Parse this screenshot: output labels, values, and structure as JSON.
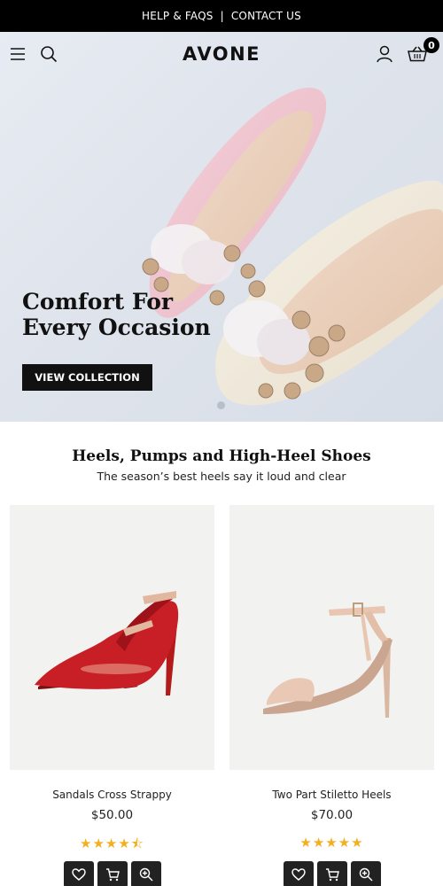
{
  "announcement": {
    "help_label": "HELP & FAQS",
    "separator": "|",
    "contact_label": "CONTACT US"
  },
  "header": {
    "logo": "AVONE",
    "cart_count": "0",
    "icons": [
      "menu-icon",
      "search-icon",
      "account-icon",
      "basket-icon"
    ]
  },
  "hero": {
    "title_line1": "Comfort For",
    "title_line2": "Every Occasion",
    "button_label": "VIEW COLLECTION"
  },
  "section": {
    "title": "Heels, Pumps and High-Heel Shoes",
    "subtitle": "The season’s best heels say it loud and clear"
  },
  "products": [
    {
      "name": "Sandals Cross Strappy",
      "price": "$50.00",
      "rating": 4.5,
      "stars": "★★★★⯪"
    },
    {
      "name": "Two Part Stiletto Heels",
      "price": "$70.00",
      "rating": 5,
      "stars": "★★★★★"
    }
  ],
  "product_actions": [
    "heart-icon",
    "cart-icon",
    "zoom-icon"
  ],
  "colors": {
    "topbar": "#000000",
    "accent_star": "#f2b01e",
    "button_dark": "#111111"
  }
}
